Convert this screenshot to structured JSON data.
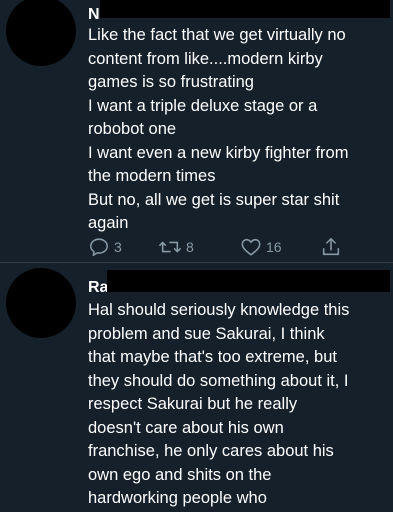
{
  "tweets": [
    {
      "author_visible": "N",
      "handle_visible": "",
      "lines": [
        "Like the fact that we get virtually no",
        "content from like....modern kirby",
        "games is so frustrating",
        "I want a triple deluxe stage or a",
        "robobot one",
        "I want even a new kirby fighter from",
        "the modern times",
        "But no, all we get is super star shit",
        "again"
      ],
      "actions": {
        "replies": "3",
        "retweets": "8",
        "likes": "16"
      }
    },
    {
      "author_visible": "Ra",
      "lines": [
        "Hal should seriously knowledge this",
        "problem and sue Sakurai, I think",
        "that maybe that's too extreme, but",
        "they should do something about it, I",
        "respect Sakurai but he really",
        "doesn't care about his own",
        "franchise, he only cares about his",
        "own ego and shits on the",
        "hardworking people who"
      ]
    }
  ],
  "icons": {
    "reply": "reply-icon",
    "retweet": "retweet-icon",
    "like": "heart-icon",
    "share": "share-icon"
  },
  "colors": {
    "background": "#15202b",
    "text": "#ffffff",
    "muted": "#8899a6",
    "redaction": "#000000"
  }
}
